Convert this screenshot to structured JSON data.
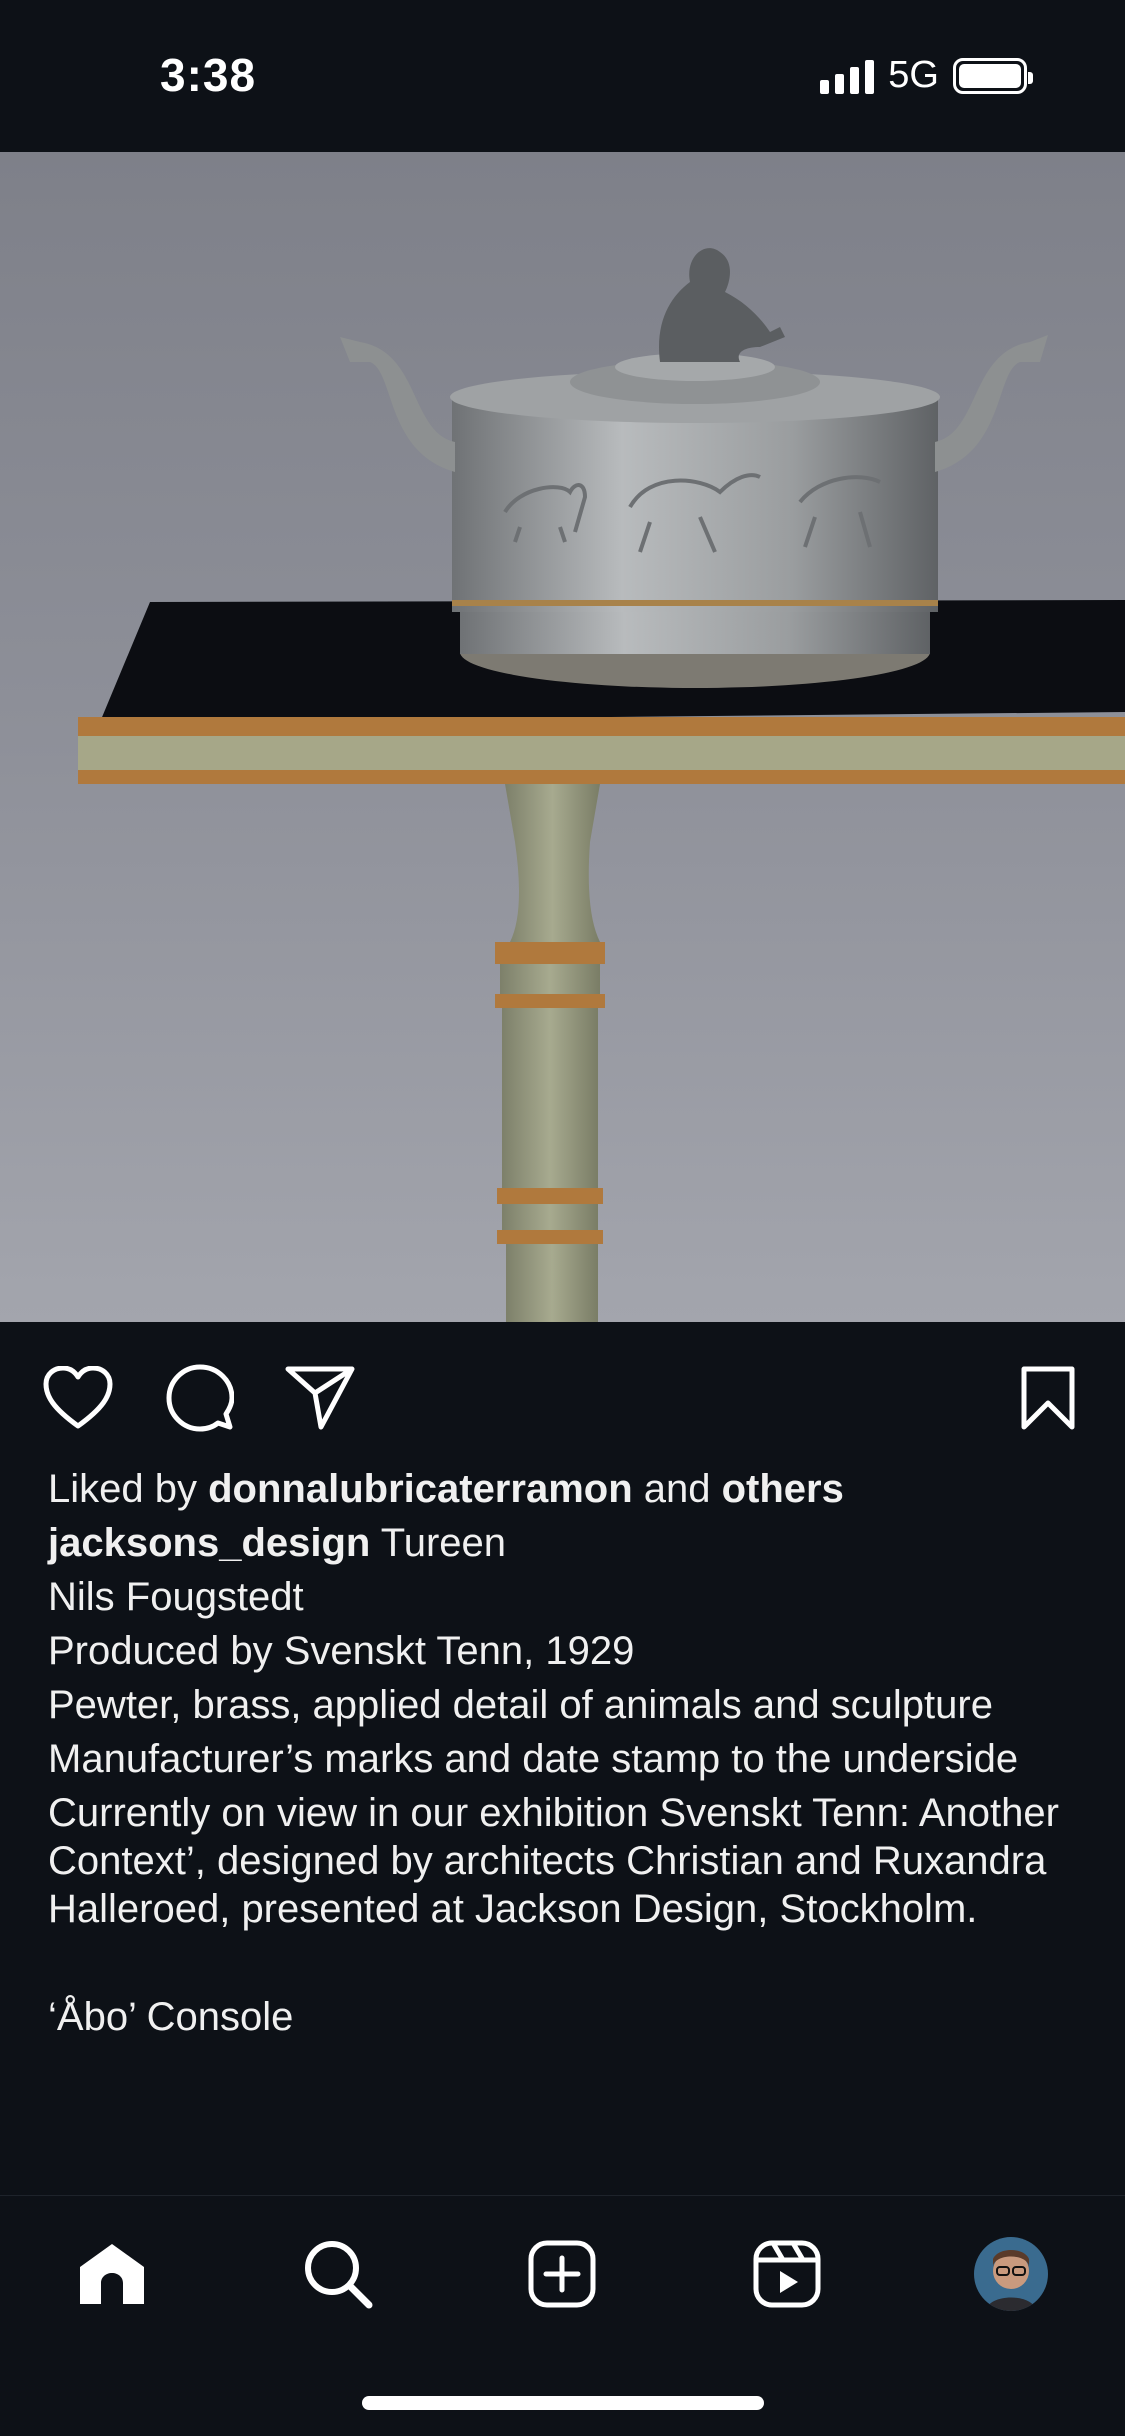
{
  "status_bar": {
    "time": "3:38",
    "network": "5G",
    "signal_bars": 4,
    "battery_level": 1.0
  },
  "post": {
    "image_icon": "photo-pewter-tureen-on-console",
    "actions": {
      "like_icon": "heart-icon",
      "comment_icon": "comment-icon",
      "share_icon": "send-icon",
      "save_icon": "bookmark-icon"
    },
    "likes": {
      "prefix": "Liked by ",
      "user": "donnalubricaterramon",
      "middle": " and ",
      "suffix": "others"
    },
    "caption": {
      "username": "jacksons_design",
      "first_line": " Tureen",
      "lines": [
        "Nils Fougstedt",
        "Produced by Svenskt Tenn, 1929",
        "Pewter, brass, applied detail of animals and sculpture",
        "Manufacturer’s marks and date stamp to the underside",
        "Currently on view in our exhibition Svenskt Tenn: Another Context’, designed by architects Christian and Ruxandra Halleroed, presented at Jackson Design, Stockholm."
      ],
      "last_line": "‘Åbo’ Console"
    }
  },
  "tabbar": {
    "items": [
      "home-icon",
      "search-icon",
      "create-icon",
      "reels-icon",
      "profile-avatar"
    ]
  },
  "colors": {
    "background": "#0d1117",
    "text": "#f2f2f2",
    "photo_backdrop": "#8b8e96"
  }
}
